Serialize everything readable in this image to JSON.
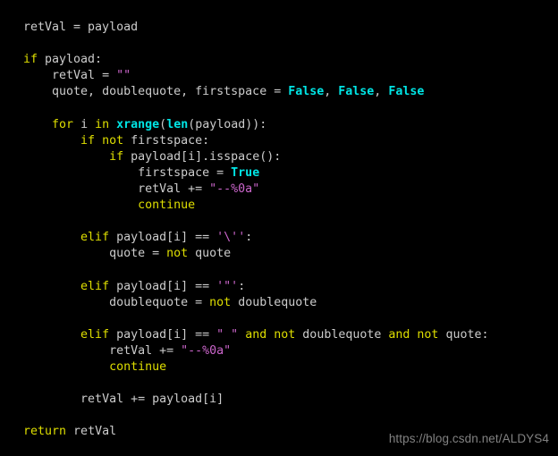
{
  "editor": {
    "background_color": "#000000",
    "default_text_color": "#cccccc",
    "keyword_color": "#dede00",
    "builtin_color": "#00e5e5",
    "constant_color": "#00e5e5",
    "string_color": "#cc66cc",
    "language": "Python"
  },
  "watermark": {
    "text": "https://blog.csdn.net/ALDYS4",
    "color": "#8d8d8d"
  },
  "code": {
    "lines": [
      {
        "id": 1,
        "indent": 0,
        "tokens": [
          {
            "t": "retVal = payload",
            "c": "plain"
          }
        ]
      },
      {
        "id": 2,
        "indent": 0,
        "tokens": []
      },
      {
        "id": 3,
        "indent": 0,
        "tokens": [
          {
            "t": "if",
            "c": "kw"
          },
          {
            "t": " payload:",
            "c": "plain"
          }
        ]
      },
      {
        "id": 4,
        "indent": 4,
        "tokens": [
          {
            "t": "retVal = ",
            "c": "plain"
          },
          {
            "t": "\"\"",
            "c": "str"
          }
        ]
      },
      {
        "id": 5,
        "indent": 4,
        "tokens": [
          {
            "t": "quote, doublequote, firstspace = ",
            "c": "plain"
          },
          {
            "t": "False",
            "c": "const"
          },
          {
            "t": ", ",
            "c": "plain"
          },
          {
            "t": "False",
            "c": "const"
          },
          {
            "t": ", ",
            "c": "plain"
          },
          {
            "t": "False",
            "c": "const"
          }
        ]
      },
      {
        "id": 6,
        "indent": 0,
        "tokens": []
      },
      {
        "id": 7,
        "indent": 4,
        "tokens": [
          {
            "t": "for",
            "c": "kw"
          },
          {
            "t": " i ",
            "c": "plain"
          },
          {
            "t": "in",
            "c": "kw"
          },
          {
            "t": " ",
            "c": "plain"
          },
          {
            "t": "xrange",
            "c": "builtin"
          },
          {
            "t": "(",
            "c": "plain"
          },
          {
            "t": "len",
            "c": "builtin"
          },
          {
            "t": "(payload)):",
            "c": "plain"
          }
        ]
      },
      {
        "id": 8,
        "indent": 8,
        "tokens": [
          {
            "t": "if",
            "c": "kw"
          },
          {
            "t": " ",
            "c": "plain"
          },
          {
            "t": "not",
            "c": "kw"
          },
          {
            "t": " firstspace:",
            "c": "plain"
          }
        ]
      },
      {
        "id": 9,
        "indent": 12,
        "tokens": [
          {
            "t": "if",
            "c": "kw"
          },
          {
            "t": " payload[i].isspace():",
            "c": "plain"
          }
        ]
      },
      {
        "id": 10,
        "indent": 16,
        "tokens": [
          {
            "t": "firstspace = ",
            "c": "plain"
          },
          {
            "t": "True",
            "c": "const"
          }
        ]
      },
      {
        "id": 11,
        "indent": 16,
        "tokens": [
          {
            "t": "retVal += ",
            "c": "plain"
          },
          {
            "t": "\"--%0a\"",
            "c": "str"
          }
        ]
      },
      {
        "id": 12,
        "indent": 16,
        "tokens": [
          {
            "t": "continue",
            "c": "kw"
          }
        ]
      },
      {
        "id": 13,
        "indent": 0,
        "tokens": []
      },
      {
        "id": 14,
        "indent": 8,
        "tokens": [
          {
            "t": "elif",
            "c": "kw"
          },
          {
            "t": " payload[i] == ",
            "c": "plain"
          },
          {
            "t": "'\\''",
            "c": "str"
          },
          {
            "t": ":",
            "c": "plain"
          }
        ]
      },
      {
        "id": 15,
        "indent": 12,
        "tokens": [
          {
            "t": "quote = ",
            "c": "plain"
          },
          {
            "t": "not",
            "c": "kw"
          },
          {
            "t": " quote",
            "c": "plain"
          }
        ]
      },
      {
        "id": 16,
        "indent": 0,
        "tokens": []
      },
      {
        "id": 17,
        "indent": 8,
        "tokens": [
          {
            "t": "elif",
            "c": "kw"
          },
          {
            "t": " payload[i] == ",
            "c": "plain"
          },
          {
            "t": "'\"'",
            "c": "str"
          },
          {
            "t": ":",
            "c": "plain"
          }
        ]
      },
      {
        "id": 18,
        "indent": 12,
        "tokens": [
          {
            "t": "doublequote = ",
            "c": "plain"
          },
          {
            "t": "not",
            "c": "kw"
          },
          {
            "t": " doublequote",
            "c": "plain"
          }
        ]
      },
      {
        "id": 19,
        "indent": 0,
        "tokens": []
      },
      {
        "id": 20,
        "indent": 8,
        "tokens": [
          {
            "t": "elif",
            "c": "kw"
          },
          {
            "t": " payload[i] == ",
            "c": "plain"
          },
          {
            "t": "\" \"",
            "c": "str"
          },
          {
            "t": " ",
            "c": "plain"
          },
          {
            "t": "and",
            "c": "kw"
          },
          {
            "t": " ",
            "c": "plain"
          },
          {
            "t": "not",
            "c": "kw"
          },
          {
            "t": " doublequote ",
            "c": "plain"
          },
          {
            "t": "and",
            "c": "kw"
          },
          {
            "t": " ",
            "c": "plain"
          },
          {
            "t": "not",
            "c": "kw"
          },
          {
            "t": " quote:",
            "c": "plain"
          }
        ]
      },
      {
        "id": 21,
        "indent": 12,
        "tokens": [
          {
            "t": "retVal += ",
            "c": "plain"
          },
          {
            "t": "\"--%0a\"",
            "c": "str"
          }
        ]
      },
      {
        "id": 22,
        "indent": 12,
        "tokens": [
          {
            "t": "continue",
            "c": "kw"
          }
        ]
      },
      {
        "id": 23,
        "indent": 0,
        "tokens": []
      },
      {
        "id": 24,
        "indent": 8,
        "tokens": [
          {
            "t": "retVal += payload[i]",
            "c": "plain"
          }
        ]
      },
      {
        "id": 25,
        "indent": 0,
        "tokens": []
      },
      {
        "id": 26,
        "indent": 0,
        "tokens": [
          {
            "t": "return",
            "c": "kw"
          },
          {
            "t": " retVal",
            "c": "plain"
          }
        ]
      }
    ]
  }
}
